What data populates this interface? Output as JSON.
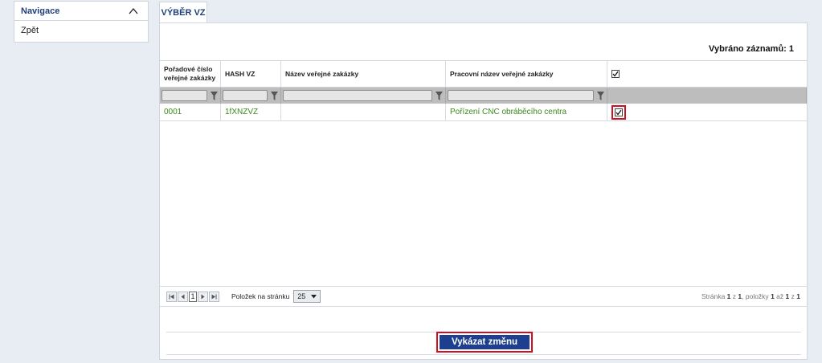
{
  "navigation": {
    "title": "Navigace",
    "items": [
      {
        "label": "Zpět"
      }
    ]
  },
  "tab": {
    "label": "VÝBĚR VZ"
  },
  "selection": {
    "text": "Vybráno záznamů: 1"
  },
  "grid": {
    "headers": [
      "Pořadové číslo veřejné zakázky",
      "HASH VZ",
      "Název veřejné zakázky",
      "Pracovní název veřejné zakázky"
    ],
    "rows": [
      {
        "number": "0001",
        "hash": "1fXNZVZ",
        "name": "",
        "working_name": "Pořízení CNC obráběcího centra",
        "checked": true
      }
    ]
  },
  "pager": {
    "current_page": "1",
    "per_page_label": "Položek na stránku",
    "per_page_value": "25",
    "info": {
      "page_word": "Stránka",
      "page": "1",
      "of_word": "z",
      "pages": "1",
      "items_word": ", položky",
      "from": "1",
      "to_word": "až",
      "to": "1",
      "total_word": "z",
      "total": "1"
    }
  },
  "actions": {
    "submit_label": "Vykázat změnu"
  },
  "colors": {
    "accent": "#1d3f8f",
    "highlight": "#d0101e",
    "row_text": "#3b8a1d"
  }
}
